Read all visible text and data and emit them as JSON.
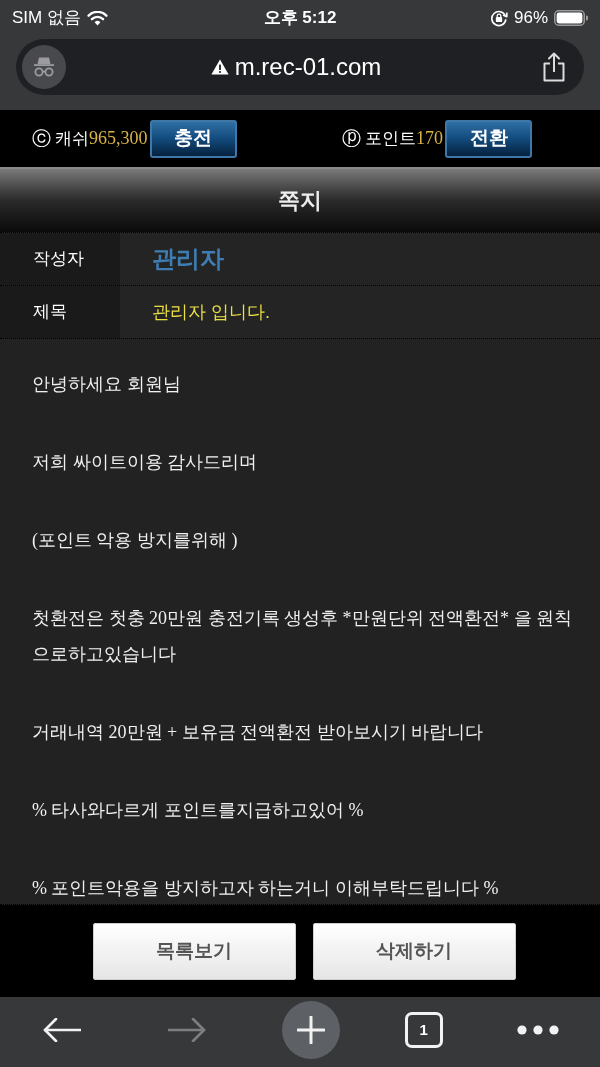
{
  "status_bar": {
    "carrier": "SIM 없음",
    "time": "오후 5:12",
    "battery": "96%"
  },
  "address_bar": {
    "url": "m.rec-01.com"
  },
  "balance_bar": [
    {
      "symbol": "ⓒ",
      "label": "캐쉬",
      "amount": "965,300",
      "button": "충전"
    },
    {
      "symbol": "ⓟ",
      "label": "포인트",
      "amount": "170",
      "button": "전환"
    }
  ],
  "page_title": "쪽지",
  "message": {
    "fields": [
      {
        "kind": "author",
        "label": "작성자",
        "value": "관리자"
      },
      {
        "kind": "subject",
        "label": "제목",
        "value": "관리자 입니다."
      }
    ],
    "body": [
      "안녕하세요 회원님",
      "저희 싸이트이용 감사드리며",
      "(포인트 악용 방지를위해 )",
      "첫환전은 첫충 20만원 충전기록 생성후 *만원단위 전액환전* 을 원칙으로하고있습니다",
      "거래내역 20만원 + 보유금 전액환전 받아보시기 바랍니다",
      "% 타사와다르게 포인트를지급하고있어 %",
      "% 포인트악용을 방지하고자 하는거니 이해부탁드립니다 %"
    ]
  },
  "actions": [
    "목록보기",
    "삭제하기"
  ],
  "toolbar": {
    "back": {
      "disabled": false
    },
    "forward": {
      "disabled": true
    },
    "tab_count": "1"
  }
}
